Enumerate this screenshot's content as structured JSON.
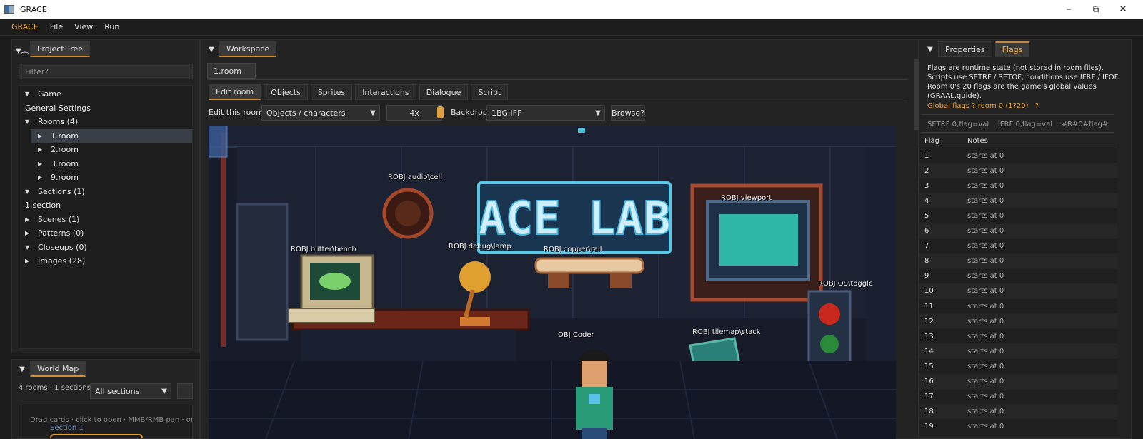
{
  "window": {
    "title": "GRACE"
  },
  "menu": {
    "brand": "GRACE",
    "items": [
      "File",
      "View",
      "Run"
    ]
  },
  "project_panel": {
    "tab": "Project Tree",
    "filter_placeholder": "Filter?",
    "tree": [
      {
        "label": "Game",
        "level": 0,
        "arrow": "down"
      },
      {
        "label": "General Settings",
        "level": 0,
        "arrow": "none"
      },
      {
        "label": "Rooms (4)",
        "level": 0,
        "arrow": "down"
      },
      {
        "label": "1.room",
        "level": 1,
        "arrow": "right",
        "selected": true
      },
      {
        "label": "2.room",
        "level": 1,
        "arrow": "right"
      },
      {
        "label": "3.room",
        "level": 1,
        "arrow": "right"
      },
      {
        "label": "9.room",
        "level": 1,
        "arrow": "right"
      },
      {
        "label": "Sections (1)",
        "level": 0,
        "arrow": "down"
      },
      {
        "label": "1.section",
        "level": 0,
        "arrow": "none"
      },
      {
        "label": "Scenes (1)",
        "level": 0,
        "arrow": "right"
      },
      {
        "label": "Patterns (0)",
        "level": 0,
        "arrow": "right"
      },
      {
        "label": "Closeups (0)",
        "level": 0,
        "arrow": "down"
      },
      {
        "label": "Images (28)",
        "level": 0,
        "arrow": "right"
      }
    ]
  },
  "world_map": {
    "tab": "World Map",
    "summary": "4 rooms · 1 sections",
    "section_filter": "All sections",
    "hint": "Drag cards · click to open · MMB/RMB pan · orange",
    "section_label": "Section 1"
  },
  "workspace": {
    "tab": "Workspace",
    "doc_tab": "1.room",
    "subtabs": [
      "Edit room",
      "Objects",
      "Sprites",
      "Interactions",
      "Dialogue",
      "Script"
    ],
    "toolbar": {
      "edit_label": "Edit this room's",
      "layer_value": "Objects / characters",
      "zoom": "4x",
      "backdrop_label": "Backdrop",
      "backdrop_value": "1BG.IFF",
      "browse": "Browse?"
    },
    "scene": {
      "sign_text": "ACE LAB",
      "objects": [
        "ROBJ audio\\cell",
        "ROBJ viewport",
        "ROBJ blitter\\bench",
        "ROBJ debug\\lamp",
        "ROBJ copper\\rail",
        "ROBJ OS\\toggle",
        "OBJ Coder",
        "ROBJ tilemap\\stack"
      ]
    }
  },
  "right_panel": {
    "tabs": [
      "Properties",
      "Flags"
    ],
    "description": "Flags are runtime state (not stored in room files). Scripts use SETRF / SETOF; conditions use IFRF / IFOF. Room 0's 20 flags are the game's global values (GRAAL.guide).",
    "global_heading": "Global flags ? room 0 (1?20)",
    "help": "?",
    "syntax": "SETRF 0,flag=val    IFRF 0,flag=val    #R#0#flag#",
    "columns": [
      "Flag",
      "Notes"
    ],
    "flags": [
      {
        "flag": "1",
        "note": "starts at 0"
      },
      {
        "flag": "2",
        "note": "starts at 0"
      },
      {
        "flag": "3",
        "note": "starts at 0"
      },
      {
        "flag": "4",
        "note": "starts at 0"
      },
      {
        "flag": "5",
        "note": "starts at 0"
      },
      {
        "flag": "6",
        "note": "starts at 0"
      },
      {
        "flag": "7",
        "note": "starts at 0"
      },
      {
        "flag": "8",
        "note": "starts at 0"
      },
      {
        "flag": "9",
        "note": "starts at 0"
      },
      {
        "flag": "10",
        "note": "starts at 0"
      },
      {
        "flag": "11",
        "note": "starts at 0"
      },
      {
        "flag": "12",
        "note": "starts at 0"
      },
      {
        "flag": "13",
        "note": "starts at 0"
      },
      {
        "flag": "14",
        "note": "starts at 0"
      },
      {
        "flag": "15",
        "note": "starts at 0"
      },
      {
        "flag": "16",
        "note": "starts at 0"
      },
      {
        "flag": "17",
        "note": "starts at 0"
      },
      {
        "flag": "18",
        "note": "starts at 0"
      },
      {
        "flag": "19",
        "note": "starts at 0"
      }
    ]
  },
  "colors": {
    "accent": "#e8a84a",
    "background": "#1b1b1b",
    "panel": "#232323"
  }
}
